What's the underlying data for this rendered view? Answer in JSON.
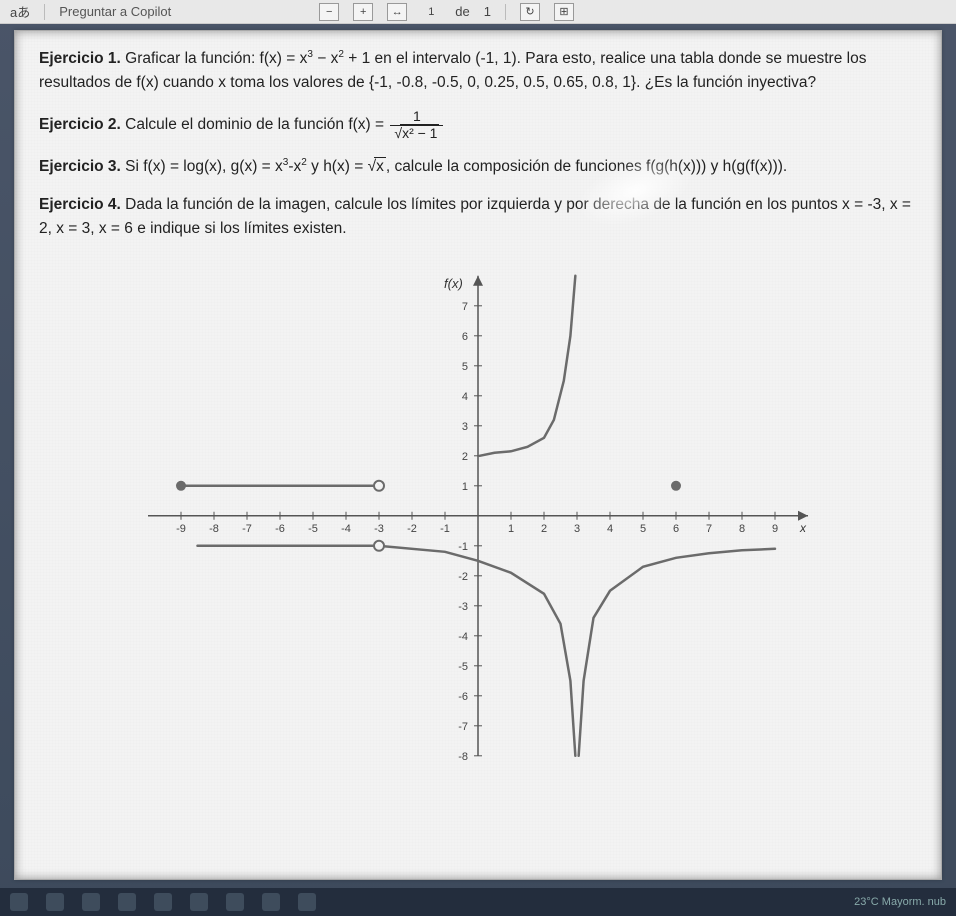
{
  "toolbar": {
    "lang_icon": "aあ",
    "copilot_label": "Preguntar a Copilot",
    "minus": "−",
    "plus": "+",
    "page_of": "de",
    "page_cur": "1",
    "page_total": "1"
  },
  "exercises": {
    "e1_title": "Ejercicio 1.",
    "e1_body_a": " Graficar la función: f(x) = x",
    "e1_sup1": "3",
    "e1_body_b": " − x",
    "e1_sup2": "2",
    "e1_body_c": " + 1 en el intervalo (-1, 1). Para esto, realice una tabla donde se muestre los resultados de f(x) cuando x toma los valores de {-1, -0.8, -0.5, 0, 0.25, 0.5, 0.65, 0.8, 1}. ¿Es la función inyectiva?",
    "e2_title": "Ejercicio 2.",
    "e2_body_a": " Calcule el dominio de la función f(x) = ",
    "e2_num": "1",
    "e2_den_in": "x² − 1",
    "e3_title": "Ejercicio 3.",
    "e3_body_a": " Si f(x) = log(x), g(x) = x",
    "e3_sup1": "3",
    "e3_body_b": "-x",
    "e3_sup2": "2",
    "e3_body_c": " y h(x) = ",
    "e3_rad": "x",
    "e3_body_d": ", calcule la composición de funciones f(g(h(x))) y h(g(f(x))).",
    "e4_title": "Ejercicio 4.",
    "e4_body": " Dada la función de la imagen, calcule los límites por izquierda y por derecha de la función en los puntos x = -3, x = 2, x = 3, x = 6 e indique si los límites existen."
  },
  "chart_data": {
    "type": "line",
    "title": "",
    "xlabel": "x",
    "ylabel": "f(x)",
    "xlim": [
      -10,
      10
    ],
    "ylim": [
      -8,
      8
    ],
    "x_ticks": [
      -9,
      -8,
      -7,
      -6,
      -5,
      -4,
      -3,
      -2,
      -1,
      1,
      2,
      3,
      4,
      5,
      6,
      7,
      8,
      9
    ],
    "y_ticks": [
      -8,
      -7,
      -6,
      -5,
      -4,
      -3,
      -2,
      -1,
      1,
      2,
      3,
      4,
      5,
      6,
      7
    ],
    "pieces": [
      {
        "description": "constant segment y≈1 on x∈[-9,-3], closed at x=-9, open at x=-3",
        "x": [
          -9,
          -3
        ],
        "y": [
          1,
          1
        ],
        "left_end": "closed",
        "right_end": "open"
      },
      {
        "description": "curve from open point (-3,-1) going down toward -∞ as x→3⁻; passes near (-8,-1),(0,-1.5),(2,-2.5)",
        "x": [
          -8.5,
          -3,
          -1,
          0,
          1,
          2,
          2.5,
          2.8,
          2.95
        ],
        "y": [
          -1,
          -1,
          -1.2,
          -1.5,
          -1.9,
          -2.6,
          -3.6,
          -5.5,
          -8
        ],
        "left_end": "open_at(-3,-1)",
        "right_end": "asymptote x=3"
      },
      {
        "description": "curve from -∞ as x→3⁺ rising to y≈-1 as x→+9, passes near (4,-2.5),(6,-1.4),(9,-1.1)",
        "x": [
          3.05,
          3.2,
          3.5,
          4,
          5,
          6,
          7,
          8,
          9
        ],
        "y": [
          -8,
          -5.5,
          -3.4,
          -2.5,
          -1.7,
          -1.4,
          -1.25,
          -1.15,
          -1.1
        ],
        "left_end": "asymptote x=3",
        "right_end": "none"
      },
      {
        "description": "curve from y≈2 at x slightly >0 rising steeply to +∞ as x→3⁻ (upper right branch)",
        "x": [
          0.05,
          0.5,
          1,
          1.5,
          2,
          2.3,
          2.6,
          2.8,
          2.95
        ],
        "y": [
          2,
          2.1,
          2.15,
          2.3,
          2.6,
          3.2,
          4.5,
          6,
          8
        ],
        "left_end": "none",
        "right_end": "asymptote x=3"
      }
    ],
    "points": [
      {
        "x": -9,
        "y": 1,
        "style": "closed"
      },
      {
        "x": -3,
        "y": 1,
        "style": "open"
      },
      {
        "x": -3,
        "y": -1,
        "style": "open"
      },
      {
        "x": 6,
        "y": 1,
        "style": "closed_isolated"
      }
    ],
    "vertical_asymptotes": [
      3
    ]
  },
  "taskbar": {
    "weather": "23°C  Mayorm. nub"
  }
}
